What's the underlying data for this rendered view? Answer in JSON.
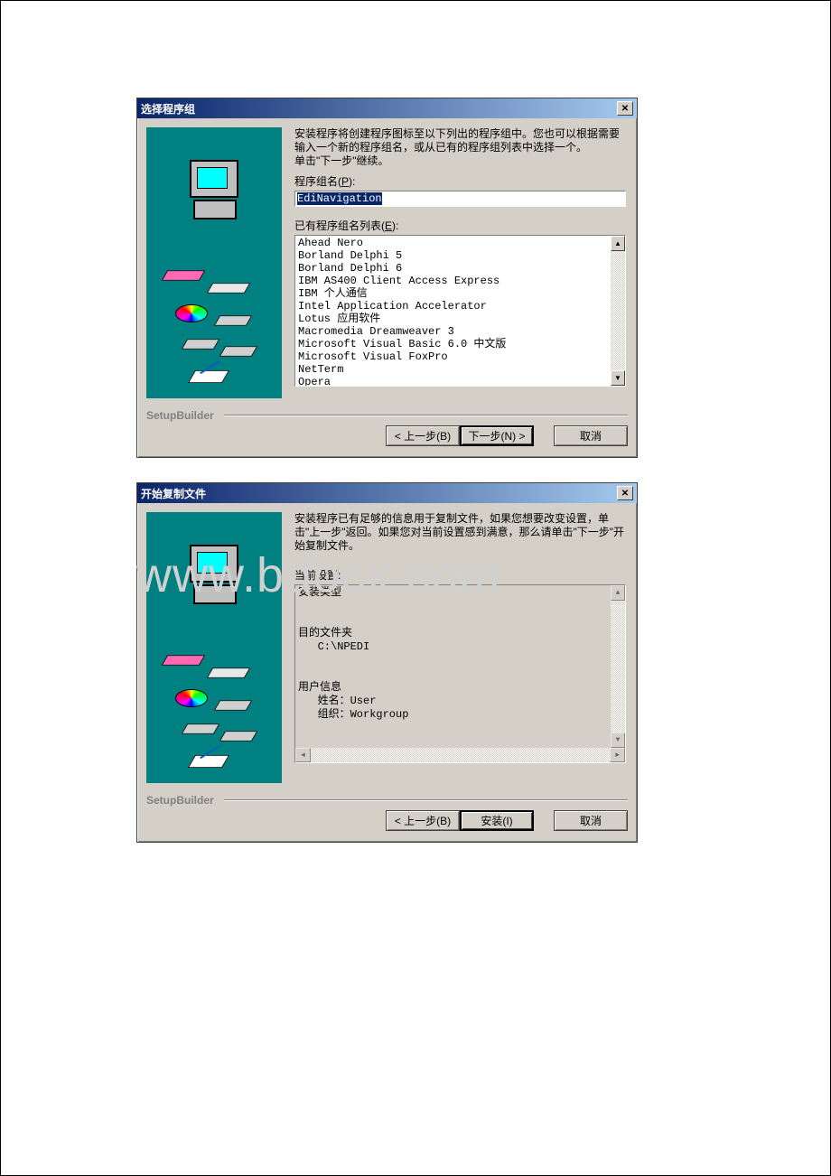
{
  "watermark": "www.bdocx.com",
  "dialog1": {
    "title": "选择程序组",
    "close_glyph": "✕",
    "description": "安装程序将创建程序图标至以下列出的程序组中。您也可以根据需要输入一个新的程序组名，或从已有的程序组列表中选择一个。\n单击\"下一步\"继续。",
    "group_name_label": "程序组名(P):",
    "group_name_value": "EdiNavigation",
    "existing_label": "已有程序组名列表(E):",
    "existing_list": [
      "Ahead Nero",
      "Borland Delphi 5",
      "Borland Delphi 6",
      "IBM AS400 Client Access Express",
      "IBM 个人通信",
      "Intel Application Accelerator",
      "Lotus 应用软件",
      "Macromedia Dreamweaver 3",
      "Microsoft Visual Basic 6.0 中文版",
      "Microsoft Visual FoxPro",
      "NetTerm",
      "Opera"
    ],
    "builder_label": "SetupBuilder",
    "back_label": "< 上一步(B)",
    "next_label": "下一步(N) >",
    "cancel_label": "取消"
  },
  "dialog2": {
    "title": "开始复制文件",
    "close_glyph": "✕",
    "description": "安装程序已有足够的信息用于复制文件，如果您想要改变设置，单击\"上一步\"返回。如果您对当前设置感到满意，那么请单击\"下一步\"开始复制文件。",
    "current_settings_label": "当前设置:",
    "settings_text": "安装类型\n\n\n目的文件夹\n   C:\\NPEDI\n\n\n用户信息\n   姓名：User\n   组织：Workgroup",
    "builder_label": "SetupBuilder",
    "back_label": "< 上一步(B)",
    "install_label": "安装(I)",
    "cancel_label": "取消"
  }
}
